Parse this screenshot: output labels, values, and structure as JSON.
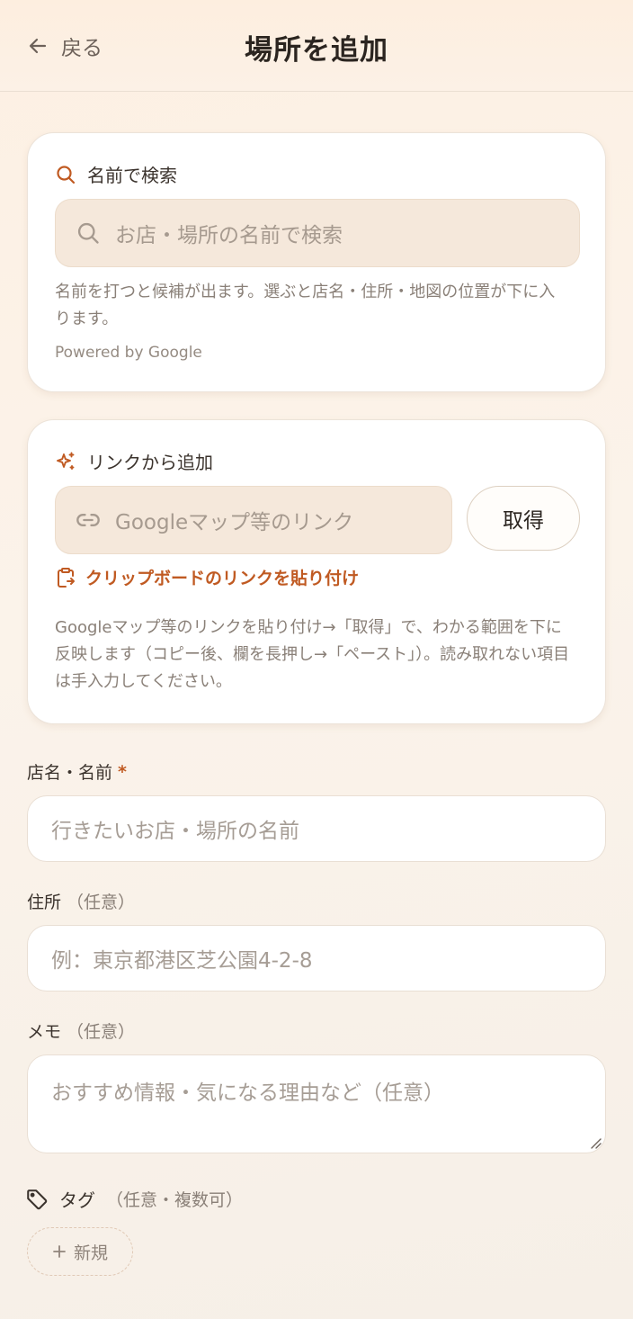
{
  "header": {
    "back_label": "戻る",
    "title": "場所を追加"
  },
  "search_card": {
    "heading": "名前で検索",
    "placeholder": "お店・場所の名前で検索",
    "help_line1": "名前を打つと候補が出ます。選ぶと店名・住所・地図の位置が下に入",
    "help_line2": "ります。",
    "powered_by": "Powered by Google"
  },
  "link_card": {
    "heading": "リンクから追加",
    "placeholder": "Googleマップ等のリンク",
    "fetch_label": "取得",
    "paste_label": "クリップボードのリンクを貼り付け",
    "help_line1": "Googleマップ等のリンクを貼り付け→「取得」で、わかる範囲を下に",
    "help_line2": "反映します（コピー後、欄を長押し→「ペースト」）。読み取れない項目",
    "help_line3": "は手入力してください。"
  },
  "form": {
    "name_label": "店名・名前",
    "name_required_mark": "*",
    "name_placeholder": "行きたいお店・場所の名前",
    "address_label": "住所",
    "address_optional": "（任意）",
    "address_placeholder": "例：東京都港区芝公園4-2-8",
    "memo_label": "メモ",
    "memo_optional": "（任意）",
    "memo_placeholder": "おすすめ情報・気になる理由など（任意）",
    "tag_label": "タグ",
    "tag_optional": "（任意・複数可）",
    "new_tag_label": "新規"
  },
  "colors": {
    "accent": "#c05a22",
    "input_beige": "#f5e8db",
    "text_muted": "#8a8078"
  },
  "icons": {
    "back": "arrow-left-icon",
    "search": "search-icon",
    "sparkle": "sparkle-icon",
    "link": "link-icon",
    "clipboard": "clipboard-icon",
    "tag": "tag-icon",
    "plus": "plus-icon"
  }
}
